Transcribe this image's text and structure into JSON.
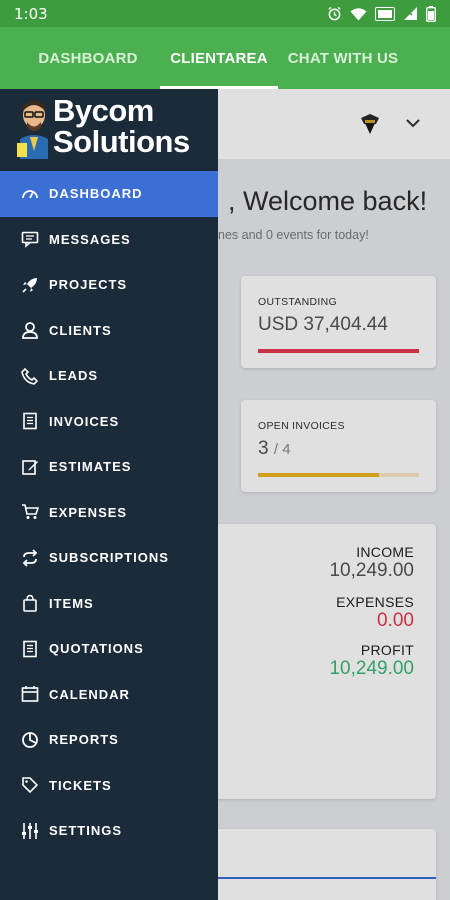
{
  "status_bar": {
    "time": "1:03"
  },
  "tabs": [
    {
      "label": "DASHBOARD"
    },
    {
      "label": "CLIENTAREA"
    },
    {
      "label": "CHAT WITH US"
    }
  ],
  "welcome": {
    "title": ", Welcome back!",
    "subtitle": "nes and 0 events for today!"
  },
  "outstanding": {
    "label": "OUTSTANDING",
    "value": "USD 37,404.44"
  },
  "open_invoices": {
    "label": "OPEN INVOICES",
    "value": "3",
    "total": "/ 4",
    "progress": 0.75
  },
  "finance": {
    "income_label": "INCOME",
    "income_value": "10,249.00",
    "expenses_label": "EXPENSES",
    "expenses_value": "0.00",
    "profit_label": "PROFIT",
    "profit_value": "10,249.00"
  },
  "drawer": {
    "brand_line1": "Bycom",
    "brand_line2": "Solutions",
    "items": [
      {
        "label": "DASHBOARD",
        "icon": "dashboard-icon"
      },
      {
        "label": "MESSAGES",
        "icon": "messages-icon"
      },
      {
        "label": "PROJECTS",
        "icon": "rocket-icon"
      },
      {
        "label": "CLIENTS",
        "icon": "user-icon"
      },
      {
        "label": "LEADS",
        "icon": "phone-icon"
      },
      {
        "label": "INVOICES",
        "icon": "invoice-icon"
      },
      {
        "label": "ESTIMATES",
        "icon": "edit-icon"
      },
      {
        "label": "EXPENSES",
        "icon": "cart-icon"
      },
      {
        "label": "SUBSCRIPTIONS",
        "icon": "refresh-icon"
      },
      {
        "label": "ITEMS",
        "icon": "bag-icon"
      },
      {
        "label": "QUOTATIONS",
        "icon": "document-icon"
      },
      {
        "label": "CALENDAR",
        "icon": "calendar-icon"
      },
      {
        "label": "REPORTS",
        "icon": "reports-icon"
      },
      {
        "label": "TICKETS",
        "icon": "ticket-icon"
      },
      {
        "label": "SETTINGS",
        "icon": "settings-icon"
      }
    ]
  },
  "colors": {
    "header_green": "#4caf50",
    "drawer_bg": "#1c2b3a",
    "active_blue": "#3b6fd4",
    "outstanding_red": "#e8384f",
    "invoice_yellow": "#f0b322",
    "expenses_red": "#e8384f",
    "profit_green": "#3cb878"
  }
}
